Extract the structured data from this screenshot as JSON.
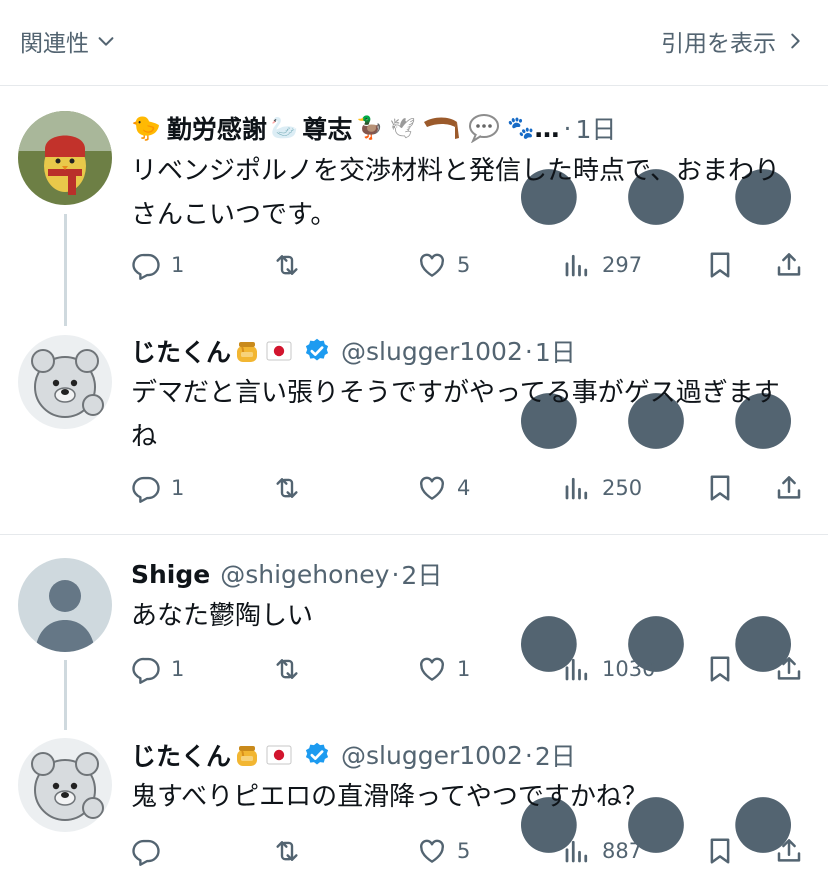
{
  "topbar": {
    "sort_label": "関連性",
    "quotes_label": "引用を表示"
  },
  "posts": [
    {
      "name": "勤労感謝",
      "name2": "尊志",
      "ellipsis": "…",
      "handle": "",
      "time": "1日",
      "text": "リベンジポルノを交渉材料と発信した時点で、おまわりさんこいつです。",
      "replies": "1",
      "reposts": "",
      "likes": "5",
      "views": "297"
    },
    {
      "name": "じたくん",
      "handle": "@slugger1002",
      "time": "1日",
      "text": "デマだと言い張りそうですがやってる事がゲス過ぎますね",
      "replies": "1",
      "reposts": "",
      "likes": "4",
      "views": "250"
    },
    {
      "name": "Shige",
      "handle": "@shigehoney",
      "time": "2日",
      "text": "あなた鬱陶しい",
      "replies": "1",
      "reposts": "",
      "likes": "1",
      "views": "1030"
    },
    {
      "name": "じたくん",
      "handle": "@slugger1002",
      "time": "2日",
      "text": "鬼すべりピエロの直滑降ってやつですかね？",
      "replies": "",
      "reposts": "",
      "likes": "5",
      "views": "887"
    }
  ],
  "colors": {
    "text": "#0f1419",
    "secondary": "#536471",
    "verified": "#1d9bf0",
    "border": "#e6e9ec"
  },
  "icons": [
    "chevron-down-icon",
    "chevron-right-icon",
    "more-icon",
    "reply-icon",
    "repost-icon",
    "like-icon",
    "views-icon",
    "bookmark-icon",
    "share-icon",
    "verified-icon",
    "honey-pot-icon",
    "japan-flag-icon"
  ]
}
